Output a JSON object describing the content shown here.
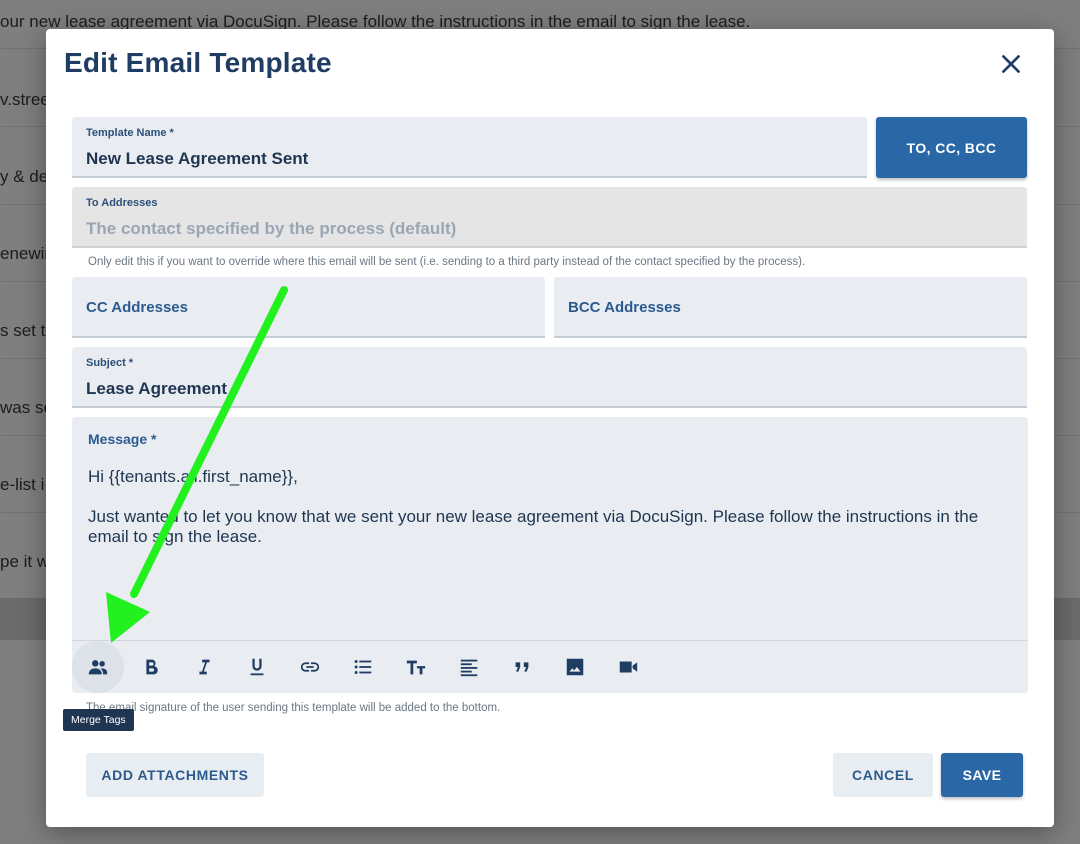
{
  "background": {
    "lines": [
      "our new lease agreement via DocuSign. Please follow the instructions in the email to sign the lease.",
      "v.stree",
      "y & det",
      "enewin",
      "s set to",
      "was se",
      "e-list i",
      "pe it w"
    ]
  },
  "modal": {
    "title": "Edit Email Template",
    "close_icon": "close-icon"
  },
  "fields": {
    "template_name": {
      "label": "Template Name *",
      "value": "New Lease Agreement Sent"
    },
    "to_addresses": {
      "label": "To Addresses",
      "placeholder": "The contact specified by the process (default)"
    },
    "to_helper": "Only edit this if you want to override where this email will be sent (i.e. sending to a third party instead of the contact specified by the process).",
    "cc": {
      "label": "CC Addresses"
    },
    "bcc": {
      "label": "BCC Addresses"
    },
    "subject": {
      "label": "Subject *",
      "value": "Lease Agreement"
    }
  },
  "recipients_button": "TO, CC, BCC",
  "message": {
    "label": "Message *",
    "paragraphs": [
      "Hi {{tenants.all.first_name}},",
      "Just wanted to let you know that we sent your new lease agreement via DocuSign. Please follow the instructions in the email to sign the lease."
    ]
  },
  "toolbar": {
    "tools": [
      "merge-tags-icon",
      "bold-icon",
      "italic-icon",
      "underline-icon",
      "link-icon",
      "list-icon",
      "text-size-icon",
      "align-icon",
      "quote-icon",
      "image-icon",
      "video-icon"
    ]
  },
  "signature_note": "The email signature of the user sending this template will be added to the bottom.",
  "tooltip": "Merge Tags",
  "footer": {
    "attach_label": "ADD ATTACHMENTS",
    "cancel_label": "CANCEL",
    "save_label": "SAVE"
  },
  "colors": {
    "primary": "#2a67a7",
    "annotation_arrow": "#22f01f"
  }
}
